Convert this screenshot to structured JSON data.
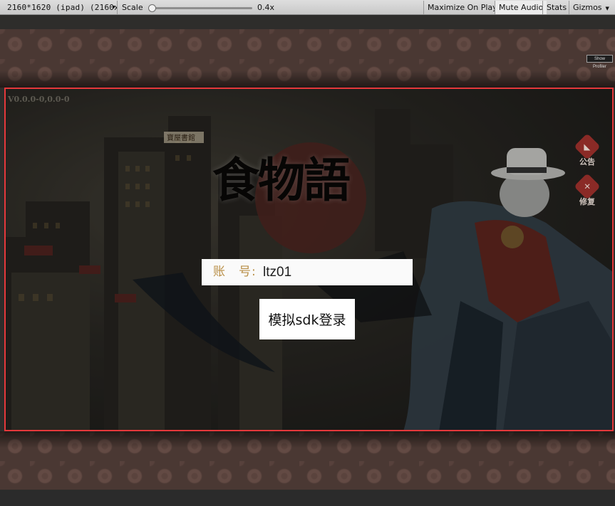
{
  "toolbar": {
    "resolution_label": "2160*1620 (ipad) (2160x",
    "scale_label": "Scale",
    "scale_value": "0.4x",
    "scale_fraction": 0,
    "maximize_on_play": "Maximize On Play",
    "mute_audio": "Mute Audio",
    "stats": "Stats",
    "gizmos": "Gizmos"
  },
  "game": {
    "show_profiler": "Show Profiler",
    "version": "V0.0.0-0,0.0-0",
    "logo_text": "食物語",
    "sign_text": "寶屋書館",
    "side_buttons": [
      {
        "label": "公告",
        "icon": "megaphone-icon",
        "glyph": "◣"
      },
      {
        "label": "修复",
        "icon": "repair-tools-icon",
        "glyph": "✕"
      }
    ],
    "account_label": "账　号:",
    "account_value": "ltz01",
    "login_button": "模拟sdk登录"
  },
  "colors": {
    "frame": "#e5383b",
    "button_red": "#8a2a26",
    "label_gold": "#b98f47"
  }
}
